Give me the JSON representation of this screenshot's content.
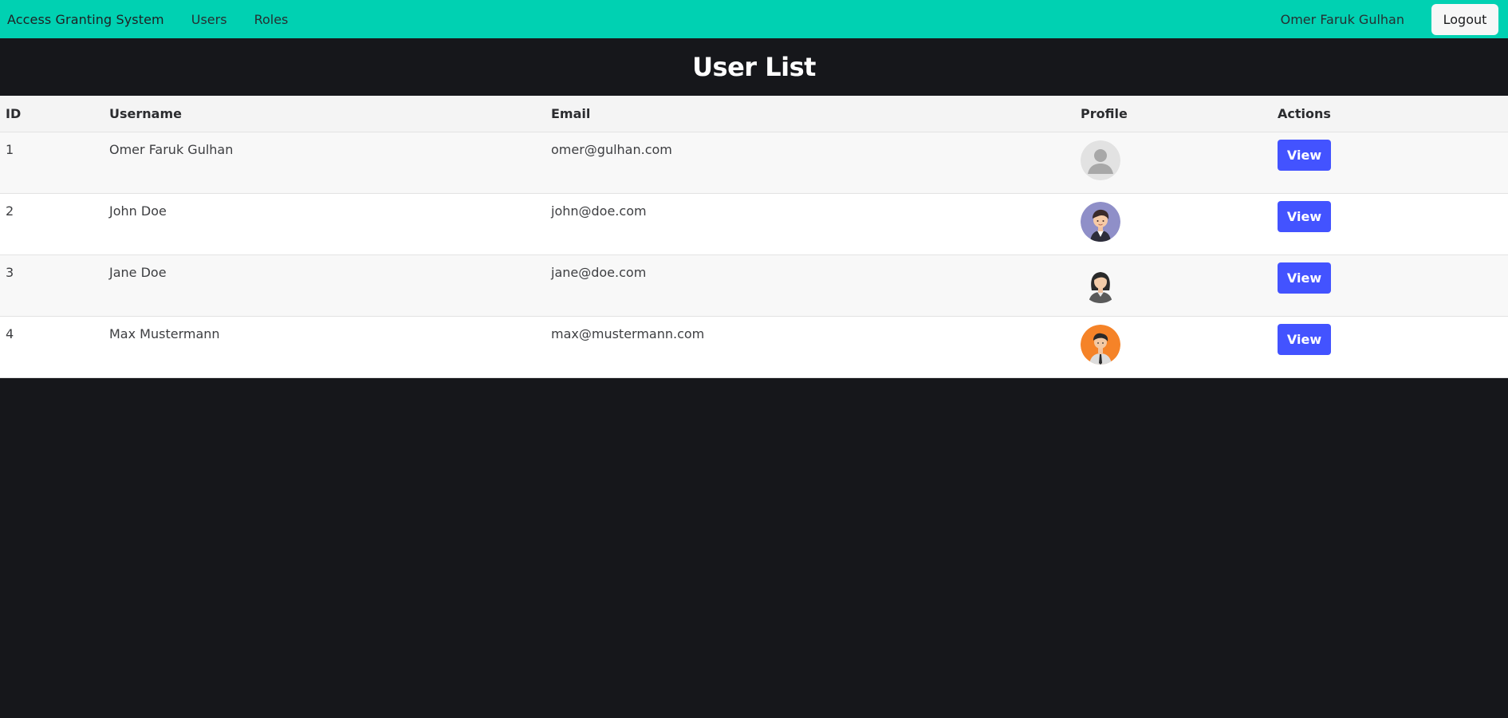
{
  "navbar": {
    "brand": "Access Granting System",
    "links": [
      {
        "label": "Users"
      },
      {
        "label": "Roles"
      }
    ],
    "user_name": "Omer Faruk Gulhan",
    "logout_label": "Logout",
    "background_color": "#00d1b2"
  },
  "page": {
    "title": "User List"
  },
  "table": {
    "headers": {
      "id": "ID",
      "username": "Username",
      "email": "Email",
      "profile": "Profile",
      "actions": "Actions"
    },
    "rows": [
      {
        "id": "1",
        "username": "Omer Faruk Gulhan",
        "email": "omer@gulhan.com",
        "avatar": "default-avatar-icon",
        "action": "View"
      },
      {
        "id": "2",
        "username": "John Doe",
        "email": "john@doe.com",
        "avatar": "man-avatar-icon",
        "action": "View"
      },
      {
        "id": "3",
        "username": "Jane Doe",
        "email": "jane@doe.com",
        "avatar": "woman-avatar-icon",
        "action": "View"
      },
      {
        "id": "4",
        "username": "Max Mustermann",
        "email": "max@mustermann.com",
        "avatar": "businessman-avatar-icon",
        "action": "View"
      }
    ],
    "action_button_color": "#4353ff"
  }
}
